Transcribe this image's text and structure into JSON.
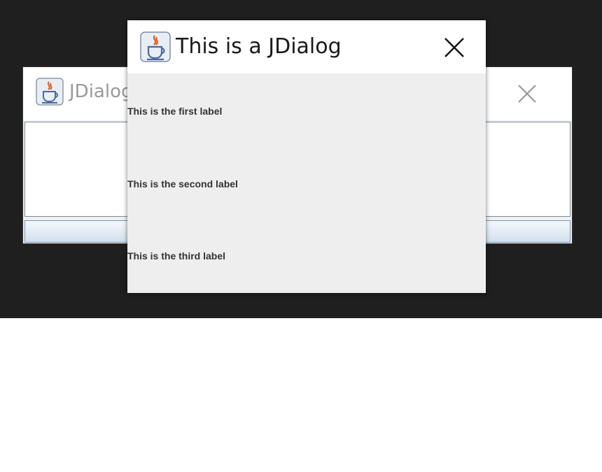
{
  "background_dialog": {
    "title": "JDialog"
  },
  "front_dialog": {
    "title": "This is a JDialog",
    "labels": [
      "This is the first label",
      "This is the second label",
      "This is the third label"
    ]
  },
  "icons": {
    "app_icon": "java-coffee-cup-icon",
    "close": "close-icon"
  },
  "colors": {
    "desktop": "#1f1f1f",
    "dialog_body": "#eeeeee",
    "titlebar": "#ffffff",
    "label_text": "#333333"
  }
}
